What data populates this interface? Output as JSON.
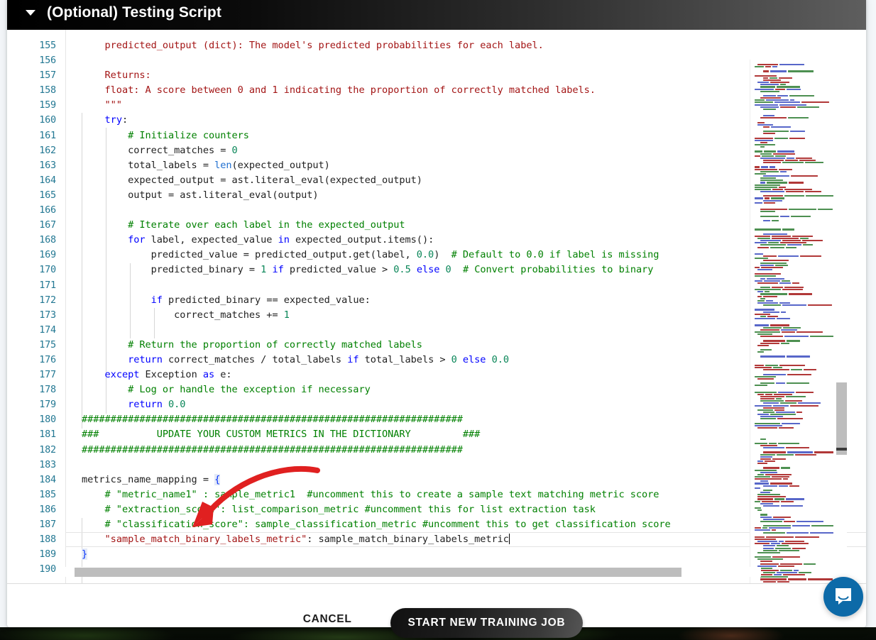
{
  "section": {
    "title": "(Optional) Testing Script",
    "caret": "caret-down-icon",
    "expanded": true
  },
  "editor": {
    "language": "python",
    "first_visible_line": 155,
    "last_visible_line": 190,
    "active_line": 188,
    "cursor_line": 188,
    "lines": [
      {
        "n": 155,
        "text": "    predicted_output (dict): The model's predicted probabilities for each label.",
        "kind": "doc"
      },
      {
        "n": 156,
        "text": "",
        "kind": "blank"
      },
      {
        "n": 157,
        "text": "    Returns:",
        "kind": "doc"
      },
      {
        "n": 158,
        "text": "    float: A score between 0 and 1 indicating the proportion of correctly matched labels.",
        "kind": "doc"
      },
      {
        "n": 159,
        "text": "    \"\"\"",
        "kind": "doc"
      },
      {
        "n": 160,
        "text": "    try:",
        "kind": "code"
      },
      {
        "n": 161,
        "text": "        # Initialize counters",
        "kind": "comment"
      },
      {
        "n": 162,
        "text": "        correct_matches = 0",
        "kind": "code"
      },
      {
        "n": 163,
        "text": "        total_labels = len(expected_output)",
        "kind": "code"
      },
      {
        "n": 164,
        "text": "        expected_output = ast.literal_eval(expected_output)",
        "kind": "code"
      },
      {
        "n": 165,
        "text": "        output = ast.literal_eval(output)",
        "kind": "code"
      },
      {
        "n": 166,
        "text": "",
        "kind": "blank"
      },
      {
        "n": 167,
        "text": "        # Iterate over each label in the expected_output",
        "kind": "comment"
      },
      {
        "n": 168,
        "text": "        for label, expected_value in expected_output.items():",
        "kind": "code"
      },
      {
        "n": 169,
        "text": "            predicted_value = predicted_output.get(label, 0.0)  # Default to 0.0 if label is missing",
        "kind": "code"
      },
      {
        "n": 170,
        "text": "            predicted_binary = 1 if predicted_value > 0.5 else 0  # Convert probabilities to binary",
        "kind": "code"
      },
      {
        "n": 171,
        "text": "",
        "kind": "blank"
      },
      {
        "n": 172,
        "text": "            if predicted_binary == expected_value:",
        "kind": "code"
      },
      {
        "n": 173,
        "text": "                correct_matches += 1",
        "kind": "code"
      },
      {
        "n": 174,
        "text": "",
        "kind": "blank"
      },
      {
        "n": 175,
        "text": "        # Return the proportion of correctly matched labels",
        "kind": "comment"
      },
      {
        "n": 176,
        "text": "        return correct_matches / total_labels if total_labels > 0 else 0.0",
        "kind": "code"
      },
      {
        "n": 177,
        "text": "    except Exception as e:",
        "kind": "code"
      },
      {
        "n": 178,
        "text": "        # Log or handle the exception if necessary",
        "kind": "comment"
      },
      {
        "n": 179,
        "text": "        return 0.0",
        "kind": "code"
      },
      {
        "n": 180,
        "text": "##################################################################",
        "kind": "comment"
      },
      {
        "n": 181,
        "text": "###          UPDATE YOUR CUSTOM METRICS IN THE DICTIONARY         ###",
        "kind": "comment"
      },
      {
        "n": 182,
        "text": "##################################################################",
        "kind": "comment"
      },
      {
        "n": 183,
        "text": "",
        "kind": "blank"
      },
      {
        "n": 184,
        "text": "metrics_name_mapping = {",
        "kind": "code"
      },
      {
        "n": 185,
        "text": "    # \"metric_name1\" : sample_metric1  #uncomment this to create a sample text matching metric score",
        "kind": "comment"
      },
      {
        "n": 186,
        "text": "    # \"extraction_score\": list_comparison_metric #uncomment this for list extraction task",
        "kind": "comment"
      },
      {
        "n": 187,
        "text": "    # \"classification_score\": sample_classification_metric #uncomment this to get classification score",
        "kind": "comment"
      },
      {
        "n": 188,
        "text": "    \"sample_match_binary_labels_metric\": sample_match_binary_labels_metric",
        "kind": "code"
      },
      {
        "n": 189,
        "text": "}",
        "kind": "code"
      },
      {
        "n": 190,
        "text": "",
        "kind": "blank"
      }
    ]
  },
  "minimap": {
    "name": "code-minimap",
    "visible": true
  },
  "scrollbars": {
    "vertical": {
      "name": "vertical-scrollbar",
      "thumb_top_pct": 59,
      "thumb_height_pct": 13
    },
    "horizontal": {
      "name": "horizontal-scrollbar",
      "thumb_left_pct": 1,
      "thumb_width_pct": 87
    }
  },
  "annotation": {
    "type": "red-curved-arrow",
    "color": "#e02020",
    "points_to": "classification_score line",
    "description": "Red curved arrow pointing at the metrics_name_mapping dictionary entries"
  },
  "footer": {
    "cancel_label": "CANCEL",
    "primary_label": "START NEW TRAINING JOB"
  },
  "chat": {
    "launcher_icon": "chat-bubble-icon",
    "color": "#0d6aa8"
  },
  "colors": {
    "keyword": "#0000ff",
    "string": "#a31515",
    "comment": "#008000",
    "number": "#098658",
    "function": "#1f6fd0",
    "line_number": "#237893",
    "header_start": "#000000",
    "header_end": "#5e5e5e",
    "primary_button": "#1c1c1c",
    "chat_blue": "#0d6aa8"
  }
}
